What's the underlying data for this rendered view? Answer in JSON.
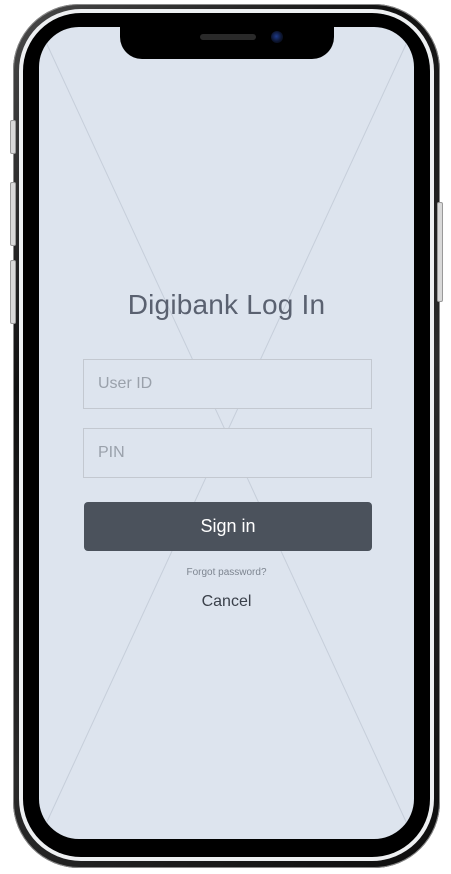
{
  "login": {
    "title": "Digibank Log In",
    "user_id_placeholder": "User ID",
    "pin_placeholder": "PIN",
    "signin_label": "Sign in",
    "forgot_label": "Forgot password?",
    "cancel_label": "Cancel"
  },
  "colors": {
    "screen_background": "#dde4ee",
    "primary_button": "#4b525c",
    "title_text": "#5a6170"
  }
}
